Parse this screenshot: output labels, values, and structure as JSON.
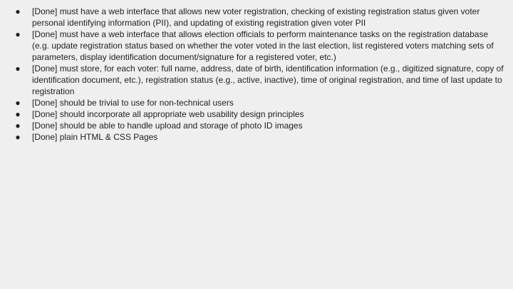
{
  "requirements": [
    {
      "bullet": "●",
      "text": "[Done] must have a web interface that allows new voter registration, checking of existing registration status given voter personal identifying information (PII), and updating of existing registration given voter PII"
    },
    {
      "bullet": "●",
      "text": "[Done] must have a web interface that allows election officials to perform maintenance tasks on the registration database (e.g. update registration status based on whether the voter voted in the last election, list registered voters matching sets of parameters, display identification document/signature for a registered voter, etc.)"
    },
    {
      "bullet": "●",
      "text": "[Done] must store, for each voter: full name, address, date of birth, identification information (e.g., digitized signature, copy of identification document, etc.), registration status (e.g., active, inactive), time of original registration, and time of last update to registration"
    },
    {
      "bullet": "●",
      "text": "[Done] should be trivial to use for non-technical users"
    },
    {
      "bullet": "●",
      "text": "[Done] should incorporate all appropriate web usability design principles"
    },
    {
      "bullet": "●",
      "text": "[Done] should be able to handle upload and storage of photo ID images"
    },
    {
      "bullet": "●",
      "text": "[Done] plain HTML & CSS Pages"
    }
  ]
}
